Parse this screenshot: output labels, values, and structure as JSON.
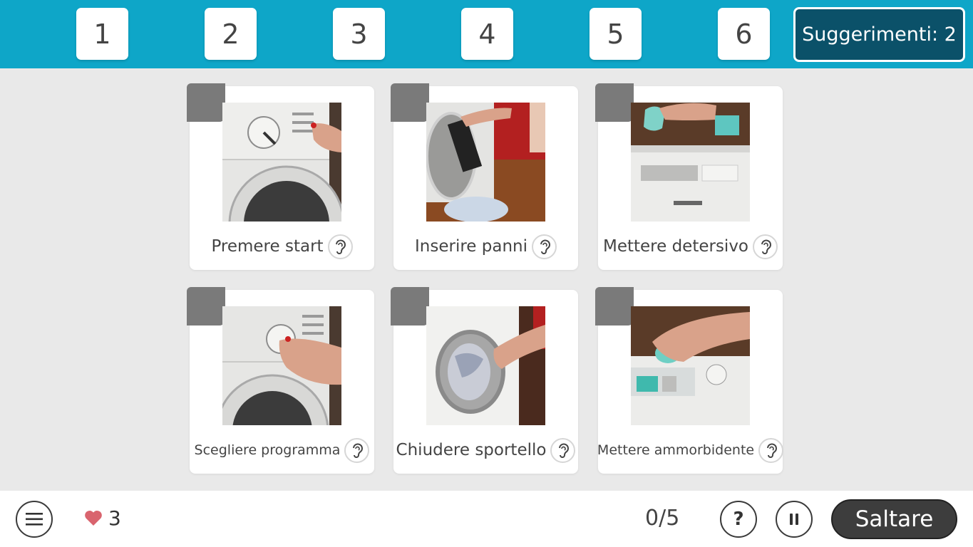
{
  "slots": [
    "1",
    "2",
    "3",
    "4",
    "5",
    "6"
  ],
  "hints_label": "Suggerimenti: 2",
  "cards": [
    {
      "label": "Premere start",
      "image": "washing-machine-dial-photo"
    },
    {
      "label": "Inserire panni",
      "image": "loading-laundry-photo"
    },
    {
      "label": "Mettere detersivo",
      "image": "pouring-detergent-photo"
    },
    {
      "label": "Scegliere programma",
      "image": "turning-dial-photo"
    },
    {
      "label": "Chiudere sportello",
      "image": "closing-door-photo"
    },
    {
      "label": "Mettere ammorbidente",
      "image": "pouring-softener-photo"
    }
  ],
  "footer": {
    "lives": "3",
    "progress": "0/5",
    "help_symbol": "?",
    "skip_label": "Saltare"
  },
  "icons": {
    "menu": "hamburger-menu-icon",
    "heart": "heart-icon",
    "audio": "ear-icon",
    "help": "question-icon",
    "pause": "pause-icon"
  },
  "colors": {
    "topbar": "#0ea6c8",
    "hints_button": "#0b5169",
    "background": "#e9e9e9",
    "heart": "#d9646e",
    "skip_button": "#3d3d3d"
  }
}
